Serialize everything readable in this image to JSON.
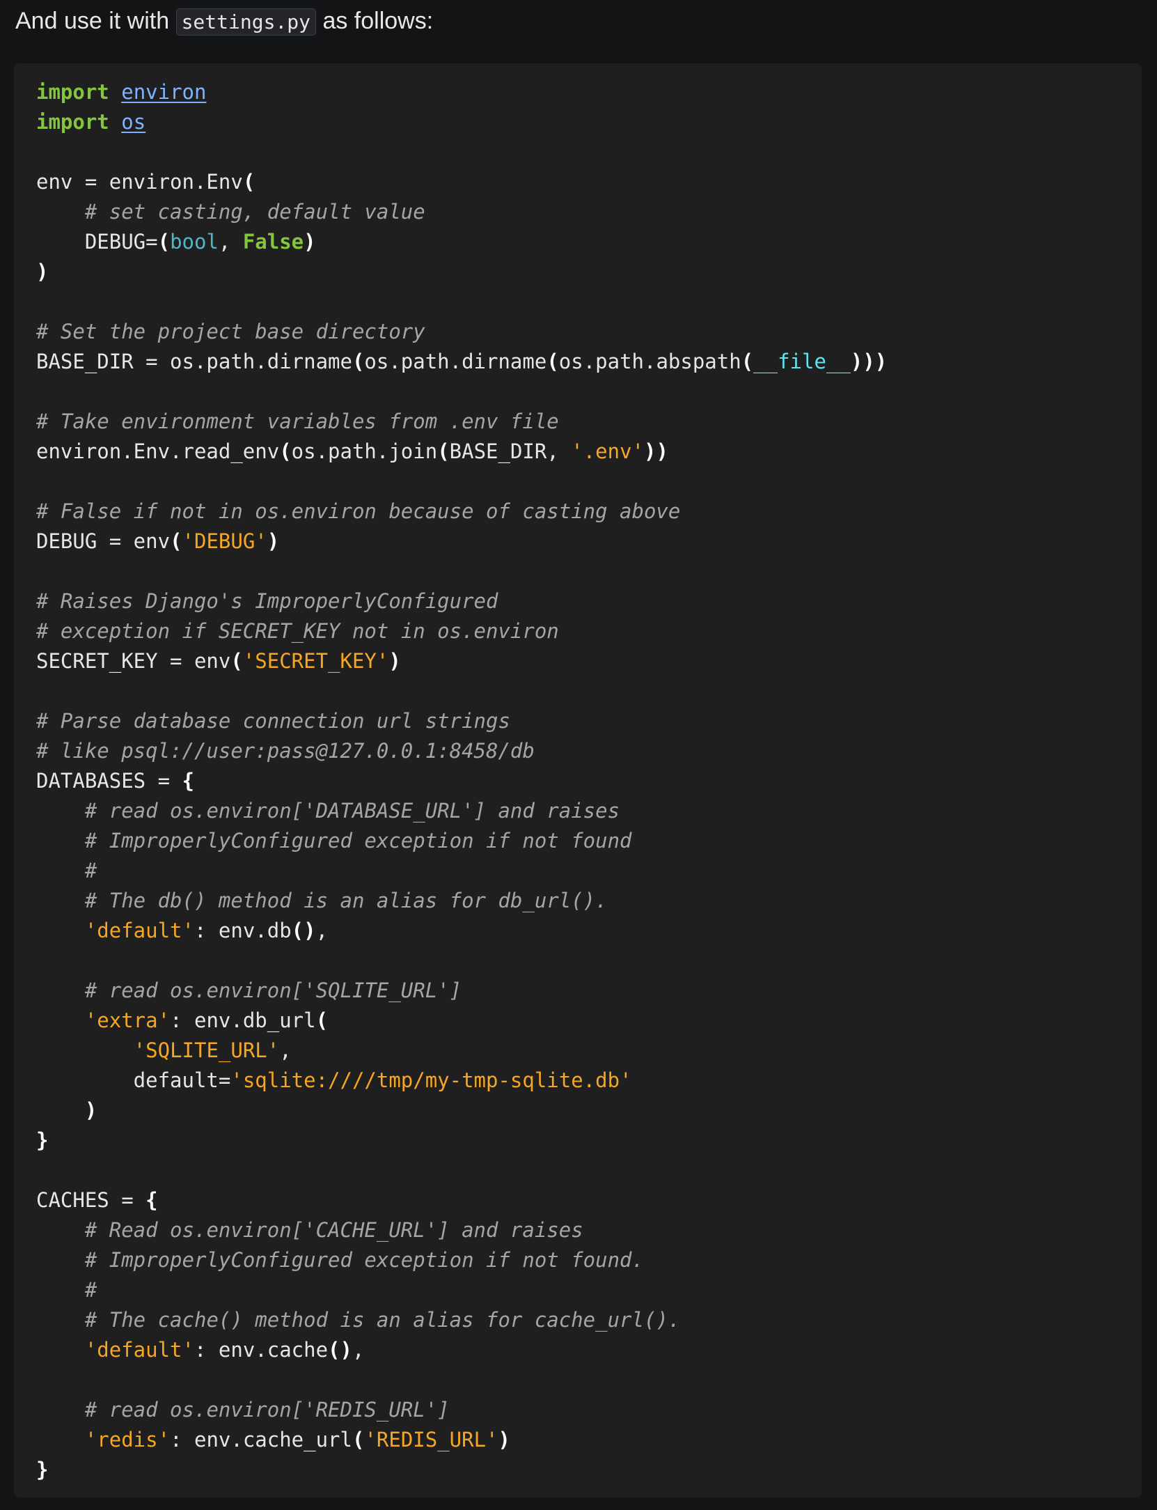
{
  "intro": {
    "before": "And use it with ",
    "code": "settings.py",
    "after": " as follows:"
  },
  "colors": {
    "background": "#131416",
    "code_background": "#1f1f1f",
    "keyword": "#84c43e",
    "module_link": "#7fb2ff",
    "builtin": "#52b6c9",
    "comment": "#a5a5a5",
    "string": "#f5a623",
    "dunder": "#5fe3ee"
  },
  "code_lines": [
    [
      [
        "keyword",
        "import"
      ],
      [
        "plain",
        " "
      ],
      [
        "module",
        "environ"
      ]
    ],
    [
      [
        "keyword",
        "import"
      ],
      [
        "plain",
        " "
      ],
      [
        "module",
        "os"
      ]
    ],
    [],
    [
      [
        "plain",
        "env = environ.Env"
      ],
      [
        "punct",
        "("
      ]
    ],
    [
      [
        "plain",
        "    "
      ],
      [
        "comment",
        "# set casting, default value"
      ]
    ],
    [
      [
        "plain",
        "    DEBUG="
      ],
      [
        "punct",
        "("
      ],
      [
        "builtin",
        "bool"
      ],
      [
        "plain",
        ", "
      ],
      [
        "const",
        "False"
      ],
      [
        "punct",
        ")"
      ]
    ],
    [
      [
        "punct",
        ")"
      ]
    ],
    [],
    [
      [
        "comment",
        "# Set the project base directory"
      ]
    ],
    [
      [
        "plain",
        "BASE_DIR = os.path.dirname"
      ],
      [
        "punct",
        "("
      ],
      [
        "plain",
        "os.path.dirname"
      ],
      [
        "punct",
        "("
      ],
      [
        "plain",
        "os.path.abspath"
      ],
      [
        "punct",
        "("
      ],
      [
        "dunder",
        "__file__"
      ],
      [
        "punct",
        ")))"
      ]
    ],
    [],
    [
      [
        "comment",
        "# Take environment variables from .env file"
      ]
    ],
    [
      [
        "plain",
        "environ.Env.read_env"
      ],
      [
        "punct",
        "("
      ],
      [
        "plain",
        "os.path.join"
      ],
      [
        "punct",
        "("
      ],
      [
        "plain",
        "BASE_DIR, "
      ],
      [
        "string",
        "'.env'"
      ],
      [
        "punct",
        "))"
      ]
    ],
    [],
    [
      [
        "comment",
        "# False if not in os.environ because of casting above"
      ]
    ],
    [
      [
        "plain",
        "DEBUG = env"
      ],
      [
        "punct",
        "("
      ],
      [
        "string",
        "'DEBUG'"
      ],
      [
        "punct",
        ")"
      ]
    ],
    [],
    [
      [
        "comment",
        "# Raises Django's ImproperlyConfigured"
      ]
    ],
    [
      [
        "comment",
        "# exception if SECRET_KEY not in os.environ"
      ]
    ],
    [
      [
        "plain",
        "SECRET_KEY = env"
      ],
      [
        "punct",
        "("
      ],
      [
        "string",
        "'SECRET_KEY'"
      ],
      [
        "punct",
        ")"
      ]
    ],
    [],
    [
      [
        "comment",
        "# Parse database connection url strings"
      ]
    ],
    [
      [
        "comment",
        "# like psql://user:pass@127.0.0.1:8458/db"
      ]
    ],
    [
      [
        "plain",
        "DATABASES = "
      ],
      [
        "punct",
        "{"
      ]
    ],
    [
      [
        "plain",
        "    "
      ],
      [
        "comment",
        "# read os.environ['DATABASE_URL'] and raises"
      ]
    ],
    [
      [
        "plain",
        "    "
      ],
      [
        "comment",
        "# ImproperlyConfigured exception if not found"
      ]
    ],
    [
      [
        "plain",
        "    "
      ],
      [
        "comment",
        "#"
      ]
    ],
    [
      [
        "plain",
        "    "
      ],
      [
        "comment",
        "# The db() method is an alias for db_url()."
      ]
    ],
    [
      [
        "plain",
        "    "
      ],
      [
        "string",
        "'default'"
      ],
      [
        "plain",
        ": env.db"
      ],
      [
        "punct",
        "()"
      ],
      [
        "plain",
        ","
      ]
    ],
    [],
    [
      [
        "plain",
        "    "
      ],
      [
        "comment",
        "# read os.environ['SQLITE_URL']"
      ]
    ],
    [
      [
        "plain",
        "    "
      ],
      [
        "string",
        "'extra'"
      ],
      [
        "plain",
        ": env.db_url"
      ],
      [
        "punct",
        "("
      ]
    ],
    [
      [
        "plain",
        "        "
      ],
      [
        "string",
        "'SQLITE_URL'"
      ],
      [
        "plain",
        ","
      ]
    ],
    [
      [
        "plain",
        "        default="
      ],
      [
        "string",
        "'sqlite:////tmp/my-tmp-sqlite.db'"
      ]
    ],
    [
      [
        "plain",
        "    "
      ],
      [
        "punct",
        ")"
      ]
    ],
    [
      [
        "punct",
        "}"
      ]
    ],
    [],
    [
      [
        "plain",
        "CACHES = "
      ],
      [
        "punct",
        "{"
      ]
    ],
    [
      [
        "plain",
        "    "
      ],
      [
        "comment",
        "# Read os.environ['CACHE_URL'] and raises"
      ]
    ],
    [
      [
        "plain",
        "    "
      ],
      [
        "comment",
        "# ImproperlyConfigured exception if not found."
      ]
    ],
    [
      [
        "plain",
        "    "
      ],
      [
        "comment",
        "#"
      ]
    ],
    [
      [
        "plain",
        "    "
      ],
      [
        "comment",
        "# The cache() method is an alias for cache_url()."
      ]
    ],
    [
      [
        "plain",
        "    "
      ],
      [
        "string",
        "'default'"
      ],
      [
        "plain",
        ": env.cache"
      ],
      [
        "punct",
        "()"
      ],
      [
        "plain",
        ","
      ]
    ],
    [],
    [
      [
        "plain",
        "    "
      ],
      [
        "comment",
        "# read os.environ['REDIS_URL']"
      ]
    ],
    [
      [
        "plain",
        "    "
      ],
      [
        "string",
        "'redis'"
      ],
      [
        "plain",
        ": env.cache_url"
      ],
      [
        "punct",
        "("
      ],
      [
        "string",
        "'REDIS_URL'"
      ],
      [
        "punct",
        ")"
      ]
    ],
    [
      [
        "punct",
        "}"
      ]
    ]
  ]
}
